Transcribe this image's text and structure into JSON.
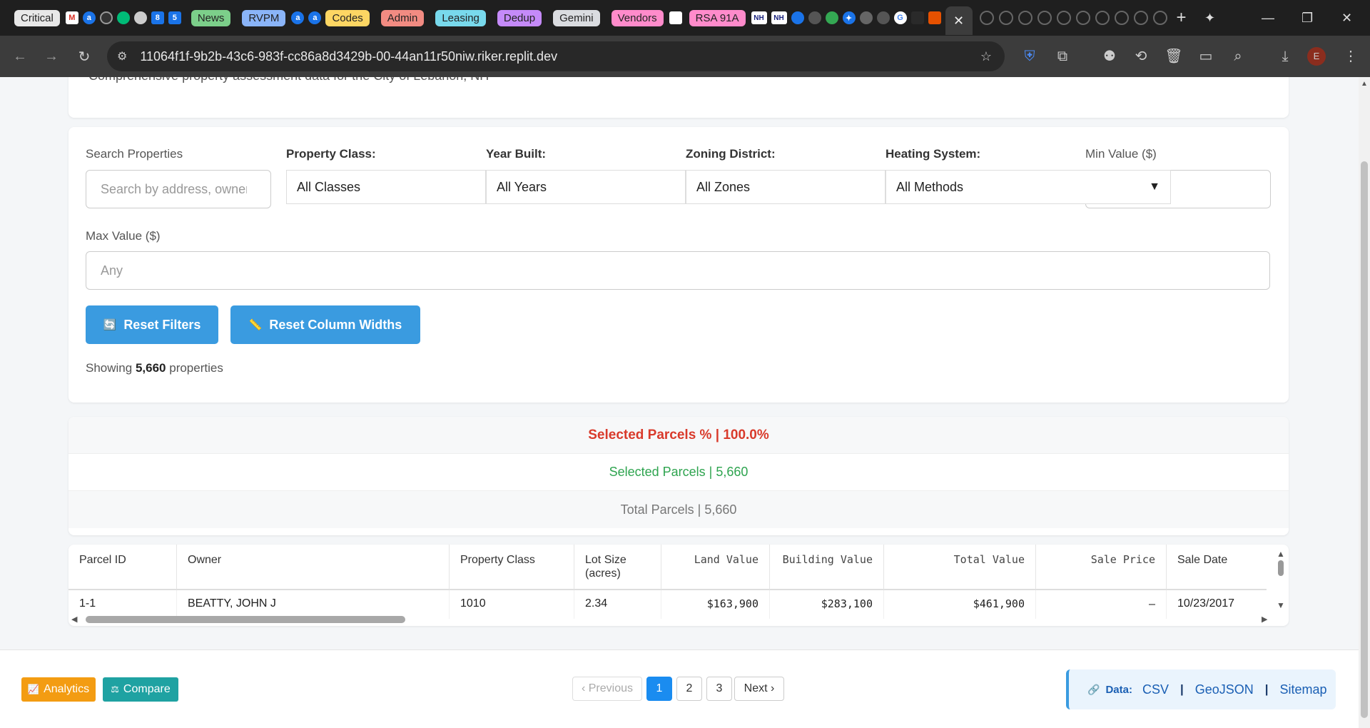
{
  "browser": {
    "tab_groups": [
      {
        "label": "Critical",
        "color": "#e8e8e8"
      },
      {
        "label": "News",
        "color": "#7ccf8a"
      },
      {
        "label": "RVPM",
        "color": "#8ab4f8"
      },
      {
        "label": "Codes",
        "color": "#fdd663"
      },
      {
        "label": "Admin",
        "color": "#f28b82"
      },
      {
        "label": "Leasing",
        "color": "#78d9ec"
      },
      {
        "label": "Dedup",
        "color": "#c58af9"
      },
      {
        "label": "Gemini",
        "color": "#dadce0"
      },
      {
        "label": "Vendors",
        "color": "#ff8bcb"
      },
      {
        "label": "RSA 91A",
        "color": "#ff8bcb"
      }
    ],
    "favicon_labels": [
      "8",
      "5",
      "NH",
      "NH"
    ],
    "url": "11064f1f-9b2b-43c6-983f-cc86a8d3429b-00-44an11r50niw.riker.replit.dev",
    "profile_initial": "E"
  },
  "header": {
    "subtitle": "Comprehensive property assessment data for the City of Lebanon, NH"
  },
  "filters": {
    "search_label": "Search Properties",
    "search_placeholder": "Search by address, owner",
    "class_label": "Property Class:",
    "class_value": "All Classes",
    "year_label": "Year Built:",
    "year_value": "All Years",
    "zoning_label": "Zoning District:",
    "zoning_value": "All Zones",
    "heating_label": "Heating System:",
    "heating_value": "All Methods",
    "min_label": "Min Value ($)",
    "max_label": "Max Value ($)",
    "max_placeholder": "Any",
    "reset_filters": "Reset Filters",
    "reset_widths": "Reset Column Widths",
    "showing_prefix": "Showing",
    "showing_count": "5,660",
    "showing_suffix": "properties"
  },
  "stats": {
    "selected_pct": "Selected Parcels % | 100.0%",
    "selected": "Selected Parcels | 5,660",
    "total": "Total Parcels | 5,660",
    "colors": {
      "pct": "#d93a2b",
      "selected": "#2ea44f",
      "total": "#777777"
    }
  },
  "table": {
    "headers": [
      "Parcel ID",
      "Owner",
      "Property Class",
      "Lot Size (acres)",
      "Land Value",
      "Building Value",
      "Total Value",
      "Sale Price",
      "Sale Date"
    ],
    "rows": [
      [
        "1-1",
        "BEATTY, JOHN J",
        "1010",
        "2.34",
        "$163,900",
        "$283,100",
        "$461,900",
        "–",
        "10/23/2017"
      ]
    ]
  },
  "footer": {
    "analytics": "Analytics",
    "compare": "Compare",
    "prev": "‹ Previous",
    "pages": [
      "1",
      "2",
      "3"
    ],
    "current_page": "1",
    "next": "Next ›",
    "data_label": "Data:",
    "csv": "CSV",
    "geojson": "GeoJSON",
    "sitemap": "Sitemap",
    "sep": "|"
  }
}
